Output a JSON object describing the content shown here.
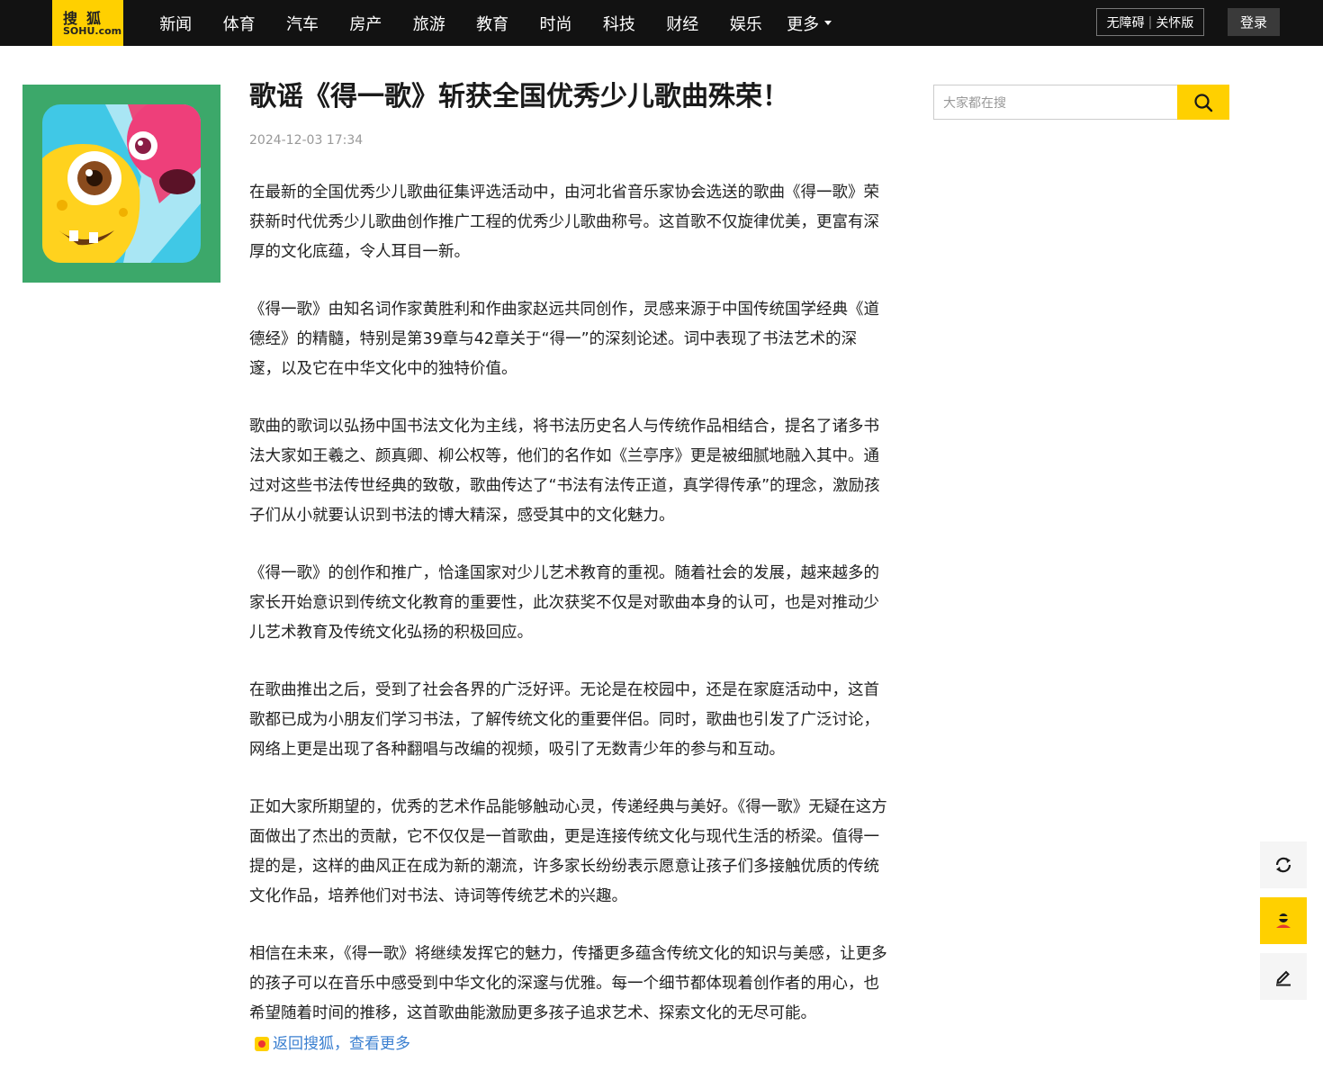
{
  "header": {
    "logo_top": "搜狐",
    "logo_bottom": "SOHU.com",
    "nav": [
      "新闻",
      "体育",
      "汽车",
      "房产",
      "旅游",
      "教育",
      "时尚",
      "科技",
      "财经",
      "娱乐"
    ],
    "more_label": "更多",
    "accessibility_left": "无障碍",
    "accessibility_right": "关怀版",
    "login_label": "登录"
  },
  "search": {
    "placeholder": "大家都在搜"
  },
  "article": {
    "title": "歌谣《得一歌》斩获全国优秀少儿歌曲殊荣！",
    "date": "2024-12-03 17:34",
    "paragraphs": [
      "在最新的全国优秀少儿歌曲征集评选活动中，由河北省音乐家协会选送的歌曲《得一歌》荣获新时代优秀少儿歌曲创作推广工程的优秀少儿歌曲称号。这首歌不仅旋律优美，更富有深厚的文化底蕴，令人耳目一新。",
      "《得一歌》由知名词作家黄胜利和作曲家赵远共同创作，灵感来源于中国传统国学经典《道德经》的精髓，特别是第39章与42章关于“得一”的深刻论述。词中表现了书法艺术的深邃，以及它在中华文化中的独特价值。",
      "歌曲的歌词以弘扬中国书法文化为主线，将书法历史名人与传统作品相结合，提名了诸多书法大家如王羲之、颜真卿、柳公权等，他们的名作如《兰亭序》更是被细腻地融入其中。通过对这些书法传世经典的致敬，歌曲传达了“书法有法传正道，真学得传承”的理念，激励孩子们从小就要认识到书法的博大精深，感受其中的文化魅力。",
      "《得一歌》的创作和推广，恰逢国家对少儿艺术教育的重视。随着社会的发展，越来越多的家长开始意识到传统文化教育的重要性，此次获奖不仅是对歌曲本身的认可，也是对推动少儿艺术教育及传统文化弘扬的积极回应。",
      "在歌曲推出之后，受到了社会各界的广泛好评。无论是在校园中，还是在家庭活动中，这首歌都已成为小朋友们学习书法，了解传统文化的重要伴侣。同时，歌曲也引发了广泛讨论，网络上更是出现了各种翻唱与改编的视频，吸引了无数青少年的参与和互动。",
      "正如大家所期望的，优秀的艺术作品能够触动心灵，传递经典与美好。《得一歌》无疑在这方面做出了杰出的贡献，它不仅仅是一首歌曲，更是连接传统文化与现代生活的桥梁。值得一提的是，这样的曲风正在成为新的潮流，许多家长纷纷表示愿意让孩子们多接触优质的传统文化作品，培养他们对书法、诗词等传统艺术的兴趣。",
      "相信在未来，《得一歌》将继续发挥它的魅力，传播更多蕴含传统文化的知识与美感，让更多的孩子可以在音乐中感受到中华文化的深邃与优雅。每一个细节都体现着创作者的用心，也希望随着时间的推移，这首歌曲能激励更多孩子追求艺术、探索文化的无尽可能。"
    ],
    "back_link": "返回搜狐，查看更多"
  },
  "side_tools": [
    "refresh-icon",
    "sohu-icon",
    "edit-icon"
  ],
  "colors": {
    "brand_yellow": "#ffd000",
    "topbar": "#121212",
    "link": "#3a7fd0",
    "cover_bg": "#3ca86a"
  }
}
